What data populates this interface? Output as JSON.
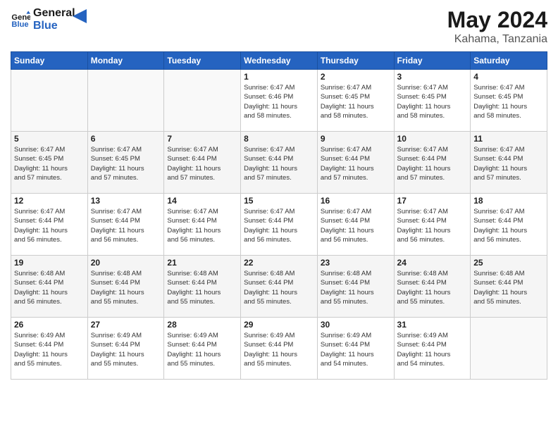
{
  "header": {
    "logo_general": "General",
    "logo_blue": "Blue",
    "title": "May 2024",
    "subtitle": "Kahama, Tanzania"
  },
  "weekdays": [
    "Sunday",
    "Monday",
    "Tuesday",
    "Wednesday",
    "Thursday",
    "Friday",
    "Saturday"
  ],
  "weeks": [
    [
      {
        "day": "",
        "info": ""
      },
      {
        "day": "",
        "info": ""
      },
      {
        "day": "",
        "info": ""
      },
      {
        "day": "1",
        "info": "Sunrise: 6:47 AM\nSunset: 6:46 PM\nDaylight: 11 hours\nand 58 minutes."
      },
      {
        "day": "2",
        "info": "Sunrise: 6:47 AM\nSunset: 6:45 PM\nDaylight: 11 hours\nand 58 minutes."
      },
      {
        "day": "3",
        "info": "Sunrise: 6:47 AM\nSunset: 6:45 PM\nDaylight: 11 hours\nand 58 minutes."
      },
      {
        "day": "4",
        "info": "Sunrise: 6:47 AM\nSunset: 6:45 PM\nDaylight: 11 hours\nand 58 minutes."
      }
    ],
    [
      {
        "day": "5",
        "info": "Sunrise: 6:47 AM\nSunset: 6:45 PM\nDaylight: 11 hours\nand 57 minutes."
      },
      {
        "day": "6",
        "info": "Sunrise: 6:47 AM\nSunset: 6:45 PM\nDaylight: 11 hours\nand 57 minutes."
      },
      {
        "day": "7",
        "info": "Sunrise: 6:47 AM\nSunset: 6:44 PM\nDaylight: 11 hours\nand 57 minutes."
      },
      {
        "day": "8",
        "info": "Sunrise: 6:47 AM\nSunset: 6:44 PM\nDaylight: 11 hours\nand 57 minutes."
      },
      {
        "day": "9",
        "info": "Sunrise: 6:47 AM\nSunset: 6:44 PM\nDaylight: 11 hours\nand 57 minutes."
      },
      {
        "day": "10",
        "info": "Sunrise: 6:47 AM\nSunset: 6:44 PM\nDaylight: 11 hours\nand 57 minutes."
      },
      {
        "day": "11",
        "info": "Sunrise: 6:47 AM\nSunset: 6:44 PM\nDaylight: 11 hours\nand 57 minutes."
      }
    ],
    [
      {
        "day": "12",
        "info": "Sunrise: 6:47 AM\nSunset: 6:44 PM\nDaylight: 11 hours\nand 56 minutes."
      },
      {
        "day": "13",
        "info": "Sunrise: 6:47 AM\nSunset: 6:44 PM\nDaylight: 11 hours\nand 56 minutes."
      },
      {
        "day": "14",
        "info": "Sunrise: 6:47 AM\nSunset: 6:44 PM\nDaylight: 11 hours\nand 56 minutes."
      },
      {
        "day": "15",
        "info": "Sunrise: 6:47 AM\nSunset: 6:44 PM\nDaylight: 11 hours\nand 56 minutes."
      },
      {
        "day": "16",
        "info": "Sunrise: 6:47 AM\nSunset: 6:44 PM\nDaylight: 11 hours\nand 56 minutes."
      },
      {
        "day": "17",
        "info": "Sunrise: 6:47 AM\nSunset: 6:44 PM\nDaylight: 11 hours\nand 56 minutes."
      },
      {
        "day": "18",
        "info": "Sunrise: 6:47 AM\nSunset: 6:44 PM\nDaylight: 11 hours\nand 56 minutes."
      }
    ],
    [
      {
        "day": "19",
        "info": "Sunrise: 6:48 AM\nSunset: 6:44 PM\nDaylight: 11 hours\nand 56 minutes."
      },
      {
        "day": "20",
        "info": "Sunrise: 6:48 AM\nSunset: 6:44 PM\nDaylight: 11 hours\nand 55 minutes."
      },
      {
        "day": "21",
        "info": "Sunrise: 6:48 AM\nSunset: 6:44 PM\nDaylight: 11 hours\nand 55 minutes."
      },
      {
        "day": "22",
        "info": "Sunrise: 6:48 AM\nSunset: 6:44 PM\nDaylight: 11 hours\nand 55 minutes."
      },
      {
        "day": "23",
        "info": "Sunrise: 6:48 AM\nSunset: 6:44 PM\nDaylight: 11 hours\nand 55 minutes."
      },
      {
        "day": "24",
        "info": "Sunrise: 6:48 AM\nSunset: 6:44 PM\nDaylight: 11 hours\nand 55 minutes."
      },
      {
        "day": "25",
        "info": "Sunrise: 6:48 AM\nSunset: 6:44 PM\nDaylight: 11 hours\nand 55 minutes."
      }
    ],
    [
      {
        "day": "26",
        "info": "Sunrise: 6:49 AM\nSunset: 6:44 PM\nDaylight: 11 hours\nand 55 minutes."
      },
      {
        "day": "27",
        "info": "Sunrise: 6:49 AM\nSunset: 6:44 PM\nDaylight: 11 hours\nand 55 minutes."
      },
      {
        "day": "28",
        "info": "Sunrise: 6:49 AM\nSunset: 6:44 PM\nDaylight: 11 hours\nand 55 minutes."
      },
      {
        "day": "29",
        "info": "Sunrise: 6:49 AM\nSunset: 6:44 PM\nDaylight: 11 hours\nand 55 minutes."
      },
      {
        "day": "30",
        "info": "Sunrise: 6:49 AM\nSunset: 6:44 PM\nDaylight: 11 hours\nand 54 minutes."
      },
      {
        "day": "31",
        "info": "Sunrise: 6:49 AM\nSunset: 6:44 PM\nDaylight: 11 hours\nand 54 minutes."
      },
      {
        "day": "",
        "info": ""
      }
    ]
  ]
}
